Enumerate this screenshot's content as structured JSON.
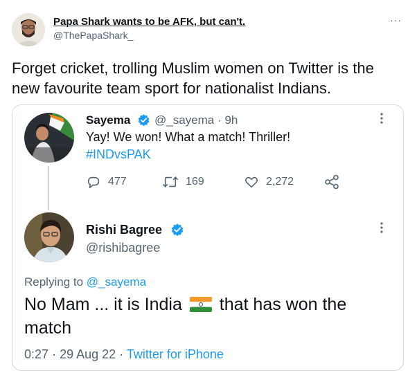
{
  "outer_tweet": {
    "display_name": "Papa Shark wants to be AFK, but can't.",
    "handle": "@ThePapaShark_",
    "more_label": "···",
    "text_line1": "Forget cricket, trolling Muslim women on Twitter is the",
    "text_line2": "new favourite team sport for nationalist Indians."
  },
  "original_tweet": {
    "display_name": "Sayema",
    "handle": "@_sayema",
    "separator": "·",
    "time": "9h",
    "text": "Yay! We won! What a match! Thriller!",
    "hashtag": "#INDvsPAK",
    "replies": "477",
    "retweets": "169",
    "likes": "2,272"
  },
  "reply_tweet": {
    "display_name": "Rishi Bagree",
    "handle": "@rishibagree",
    "replying_to_label": "Replying to",
    "replying_to_handle": "@_sayema",
    "text_part1": "No Mam ... it is India",
    "text_part2": "that has won the",
    "text_line2": "match",
    "time": "0:27",
    "date": "29 Aug 22",
    "separator": "·",
    "source": "Twitter for iPhone"
  },
  "colors": {
    "accent": "#1d9bf0",
    "text": "#0f1419",
    "muted": "#536471",
    "border": "#cfd9de"
  },
  "icons": [
    "more-icon",
    "verified-icon",
    "reply-icon",
    "retweet-icon",
    "like-icon",
    "share-icon",
    "india-flag-icon"
  ]
}
